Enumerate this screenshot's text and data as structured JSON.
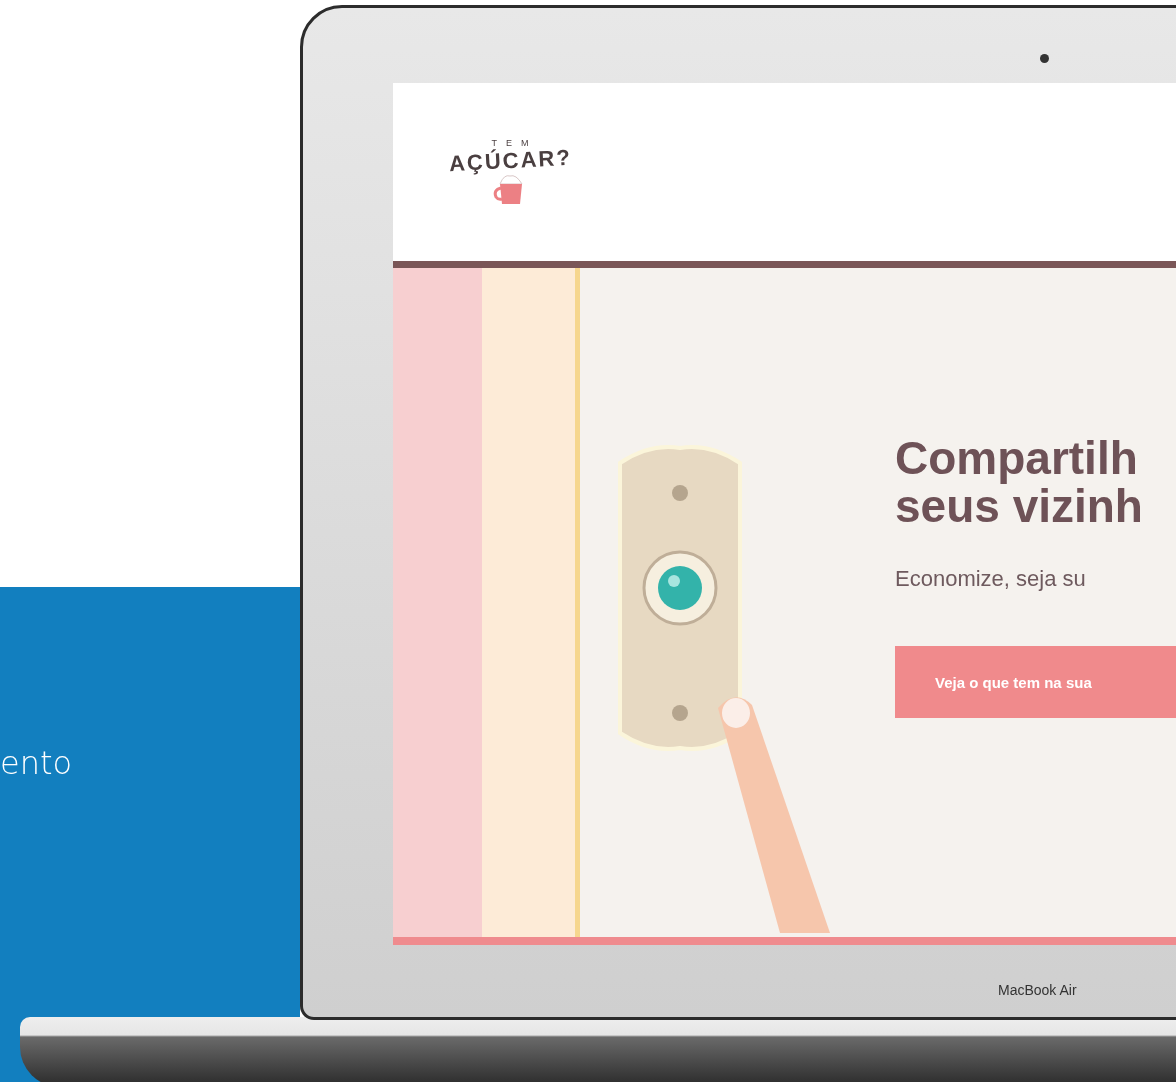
{
  "side_panel": {
    "text": "ento"
  },
  "laptop": {
    "label": "MacBook Air",
    "site": {
      "logo": {
        "top": "TEM",
        "main": "AÇÚCAR?"
      },
      "headline": [
        "Compartilh",
        "seus vizinh"
      ],
      "subtitle": "Economize, seja su",
      "cta": "Veja o que tem na sua"
    }
  }
}
